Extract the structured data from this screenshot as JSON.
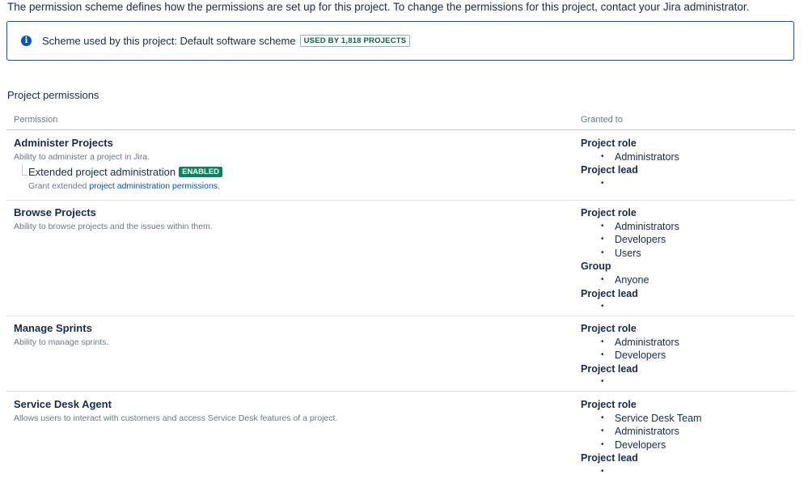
{
  "intro": "The permission scheme defines how the permissions are set up for this project. To change the permissions for this project, contact your Jira administrator.",
  "info": {
    "text": "Scheme used by this project: Default software scheme",
    "badge": "USED BY 1,818 PROJECTS",
    "icon": "info-icon"
  },
  "section_title": "Project permissions",
  "columns": {
    "permission": "Permission",
    "granted": "Granted to"
  },
  "permissions": [
    {
      "name": "Administer Projects",
      "desc": "Ability to administer a project in Jira.",
      "extended": {
        "name": "Extended project administration",
        "badge": "ENABLED",
        "desc_prefix": "Grant extended ",
        "link": "project administration permissions",
        "desc_suffix": "."
      },
      "granted": [
        {
          "label": "Project role",
          "items": [
            "Administrators"
          ]
        },
        {
          "label": "Project lead",
          "items": [
            ""
          ]
        }
      ]
    },
    {
      "name": "Browse Projects",
      "desc": "Ability to browse projects and the issues within them.",
      "granted": [
        {
          "label": "Project role",
          "items": [
            "Administrators",
            "Developers",
            "Users"
          ]
        },
        {
          "label": "Group",
          "items": [
            "Anyone"
          ]
        },
        {
          "label": "Project lead",
          "items": [
            ""
          ]
        }
      ]
    },
    {
      "name": "Manage Sprints",
      "desc": "Ability to manage sprints.",
      "granted": [
        {
          "label": "Project role",
          "items": [
            "Administrators",
            "Developers"
          ]
        },
        {
          "label": "Project lead",
          "items": [
            ""
          ]
        }
      ]
    },
    {
      "name": "Service Desk Agent",
      "desc": "Allows users to interact with customers and access Service Desk features of a project.",
      "granted": [
        {
          "label": "Project role",
          "items": [
            "Service Desk Team",
            "Administrators",
            "Developers"
          ]
        },
        {
          "label": "Project lead",
          "items": [
            ""
          ]
        }
      ]
    }
  ],
  "colors": {
    "accent": "#0052cc",
    "success": "#00875a",
    "text": "#172b4d",
    "subtle": "#6b778c"
  }
}
